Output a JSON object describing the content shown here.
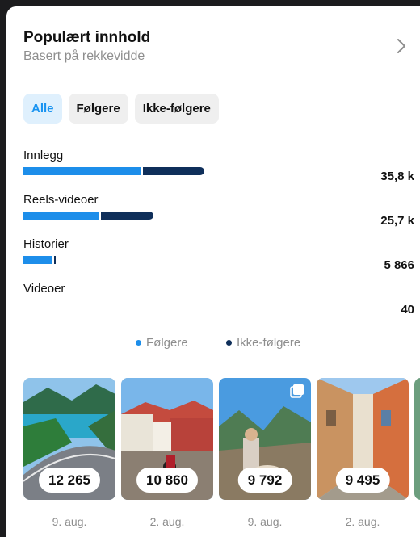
{
  "header": {
    "title": "Populært innhold",
    "subtitle": "Basert på rekkevidde"
  },
  "filters": [
    {
      "label": "Alle",
      "active": true
    },
    {
      "label": "Følgere",
      "active": false
    },
    {
      "label": "Ikke-følgere",
      "active": false
    }
  ],
  "rows": [
    {
      "label": "Innlegg",
      "value": "35,8 k"
    },
    {
      "label": "Reels-videoer",
      "value": "25,7 k"
    },
    {
      "label": "Historier",
      "value": "5 866"
    },
    {
      "label": "Videoer",
      "value": "40"
    }
  ],
  "legend": {
    "followers": "Følgere",
    "non_followers": "Ikke-følgere",
    "followers_color": "#1d8eea",
    "non_followers_color": "#0f2f5a"
  },
  "thumbnails": [
    {
      "value": "12 265",
      "date": "9. aug.",
      "scene": "fjord-road"
    },
    {
      "value": "10 860",
      "date": "2. aug.",
      "scene": "village-motorbike"
    },
    {
      "value": "9 792",
      "date": "9. aug.",
      "scene": "mountain-dog",
      "icon": "carousel-icon"
    },
    {
      "value": "9 495",
      "date": "2. aug.",
      "scene": "narrow-street"
    }
  ]
}
